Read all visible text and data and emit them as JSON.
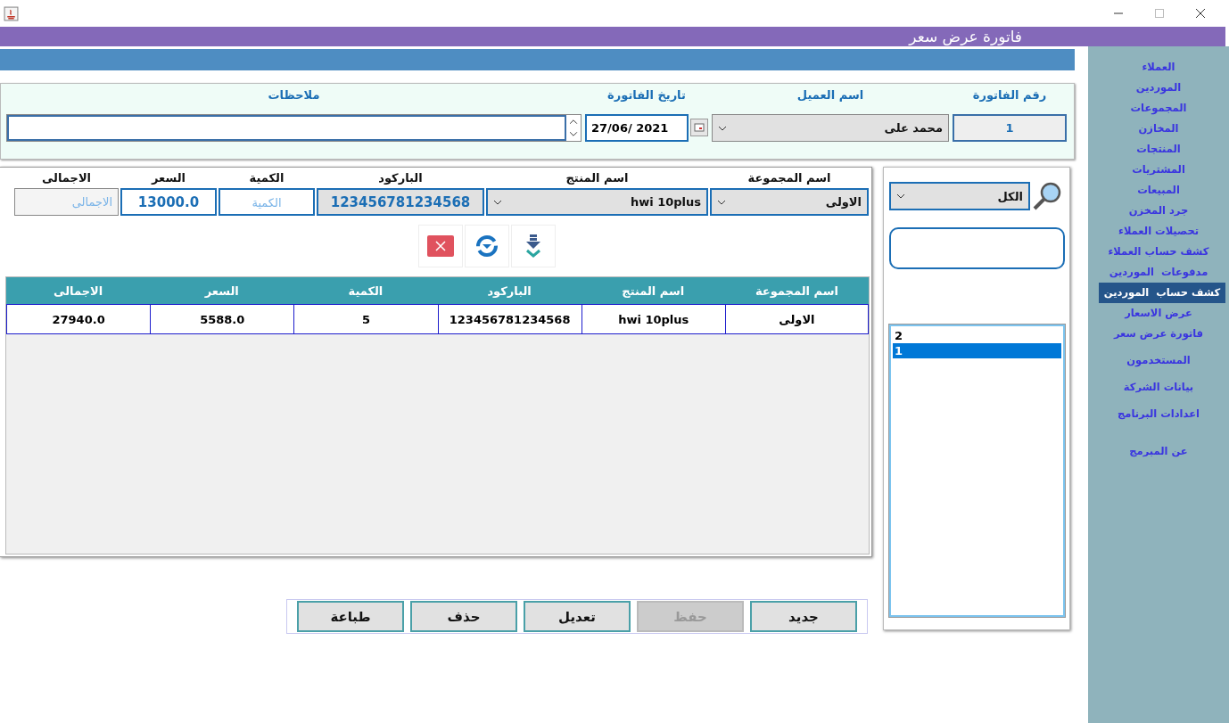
{
  "title_bar": {
    "title": "فاتورة عرض سعر"
  },
  "header": {
    "fields": [
      {
        "label": "رقم الفاتورة",
        "kind": "text",
        "value": "1"
      },
      {
        "label": "اسم العميل",
        "kind": "select",
        "value": "محمد على"
      },
      {
        "label": "تاريخ الفاتورة",
        "kind": "date",
        "value": "27/06/ 2021"
      },
      {
        "label": "ملاحظات",
        "kind": "spinner"
      }
    ]
  },
  "item_form": {
    "fields": [
      {
        "label": "اسم المجموعة",
        "kind": "select",
        "value": "الاولى"
      },
      {
        "label": "اسم المنتج",
        "kind": "select",
        "value": "hwi 10plus"
      },
      {
        "label": "الباركود",
        "kind": "text",
        "value": "123456781234568"
      },
      {
        "label": "الكمية",
        "kind": "text",
        "placeholder": "الكمية"
      },
      {
        "label": "السعر",
        "kind": "text",
        "value": "13000.0"
      },
      {
        "label": "الاجمالى",
        "kind": "readonly",
        "placeholder": "الاجمالى"
      }
    ]
  },
  "table": {
    "columns": [
      "اسم المجموعة",
      "اسم المنتج",
      "الباركود",
      "الكمية",
      "السعر",
      "الاجمالى"
    ],
    "rows": [
      [
        "الاولى",
        "hwi 10plus",
        "123456781234568",
        "5",
        "5588.0",
        "27940.0"
      ]
    ]
  },
  "filter": {
    "select": "الكل",
    "list": [
      {
        "label": "2",
        "selected": false
      },
      {
        "label": "1",
        "selected": true
      }
    ]
  },
  "buttons": [
    {
      "label": "جديد",
      "disabled": false
    },
    {
      "label": "حفظ",
      "disabled": true
    },
    {
      "label": "تعديل",
      "disabled": false
    },
    {
      "label": "حذف",
      "disabled": false
    },
    {
      "label": "طباعة",
      "disabled": false
    }
  ],
  "sidebar": {
    "items": [
      {
        "label": "العملاء",
        "selected": false
      },
      {
        "label": "الموردين",
        "selected": false
      },
      {
        "label": "المجموعات",
        "selected": false
      },
      {
        "label": "المخازن",
        "selected": false
      },
      {
        "label": "المنتجات",
        "selected": false
      },
      {
        "label": "المشتريات",
        "selected": false
      },
      {
        "label": "المبيعات",
        "selected": false
      },
      {
        "label": "جرد المخزن",
        "selected": false
      },
      {
        "label": "تحصيلات العملاء",
        "selected": false
      },
      {
        "label": "كشف حساب العملاء",
        "selected": false
      },
      {
        "label": "مدفوعات  الموردين",
        "selected": false
      },
      {
        "label": "كشف حساب  الموردين",
        "selected": true
      },
      {
        "label": "عرض الاسعار",
        "selected": false
      },
      {
        "label": "فاتورة عرض سعر",
        "selected": false
      },
      {
        "label": "المستخدمون",
        "selected": false
      },
      {
        "label": "بيانات الشركة",
        "selected": false
      },
      {
        "label": "اعدادات البرنامج",
        "selected": false
      },
      {
        "label": "عن المبرمج",
        "selected": false
      }
    ]
  }
}
